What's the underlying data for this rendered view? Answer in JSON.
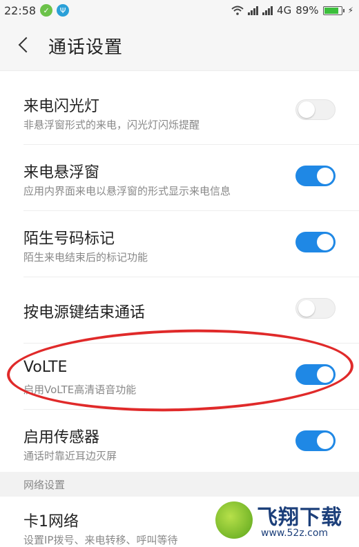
{
  "status_bar": {
    "time": "22:58",
    "network": "4G",
    "battery": "89%",
    "battery_level": 0.89,
    "icons": [
      "app-notification-icon",
      "usb-icon",
      "wifi-icon",
      "signal-icon",
      "signal-icon",
      "battery-icon",
      "charging-icon"
    ],
    "colors": {
      "app_icon": "#6cc24a",
      "usb_icon": "#2aa0d8",
      "battery_fill": "#3bbf3b"
    }
  },
  "header": {
    "title": "通话设置"
  },
  "settings": [
    {
      "label": "来电闪光灯",
      "desc": "非悬浮窗形式的来电，闪光灯闪烁提醒",
      "enabled": false
    },
    {
      "label": "来电悬浮窗",
      "desc": "应用内界面来电以悬浮窗的形式显示来电信息",
      "enabled": true
    },
    {
      "label": "陌生号码标记",
      "desc": "陌生来电结束后的标记功能",
      "enabled": true
    },
    {
      "label": "按电源键结束通话",
      "desc": "",
      "enabled": false
    },
    {
      "label": "VoLTE",
      "desc": "启用VoLTE高清语音功能",
      "enabled": true
    },
    {
      "label": "启用传感器",
      "desc": "通话时靠近耳边灭屏",
      "enabled": true
    }
  ],
  "section": {
    "title": "网络设置"
  },
  "network_item": {
    "label": "卡1网络",
    "desc": "设置IP拨号、来电转移、呼叫等待"
  },
  "watermark": {
    "text": "飞翔下载",
    "url": "www.52z.com"
  },
  "colors": {
    "accent": "#1f88e5",
    "annotation": "#e02a2a"
  }
}
